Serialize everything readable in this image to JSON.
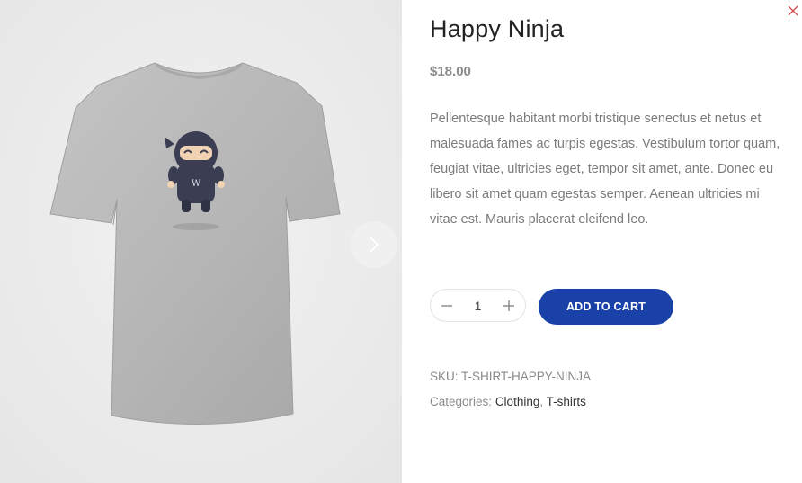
{
  "product": {
    "title": "Happy Ninja",
    "price": "$18.00",
    "description": "Pellentesque habitant morbi tristique senectus et netus et malesuada fames ac turpis egestas. Vestibulum tortor quam, feugiat vitae, ultricies eget, tempor sit amet, ante. Donec eu libero sit amet quam egestas semper. Aenean ultricies mi vitae est. Mauris placerat eleifend leo."
  },
  "cart": {
    "quantity": "1",
    "add_label": "ADD TO CART"
  },
  "meta": {
    "sku_label": "SKU:",
    "sku_value": "T-SHIRT-HAPPY-NINJA",
    "categories_label": "Categories:",
    "categories": [
      "Clothing",
      "T-shirts"
    ],
    "separator": ","
  },
  "icons": {
    "close": "close-icon",
    "next": "chevron-right-icon",
    "minus": "minus-icon",
    "plus": "plus-icon"
  },
  "colors": {
    "accent": "#1a41a8",
    "close": "#d04a4a",
    "gallery_bg": "#ebebeb"
  }
}
